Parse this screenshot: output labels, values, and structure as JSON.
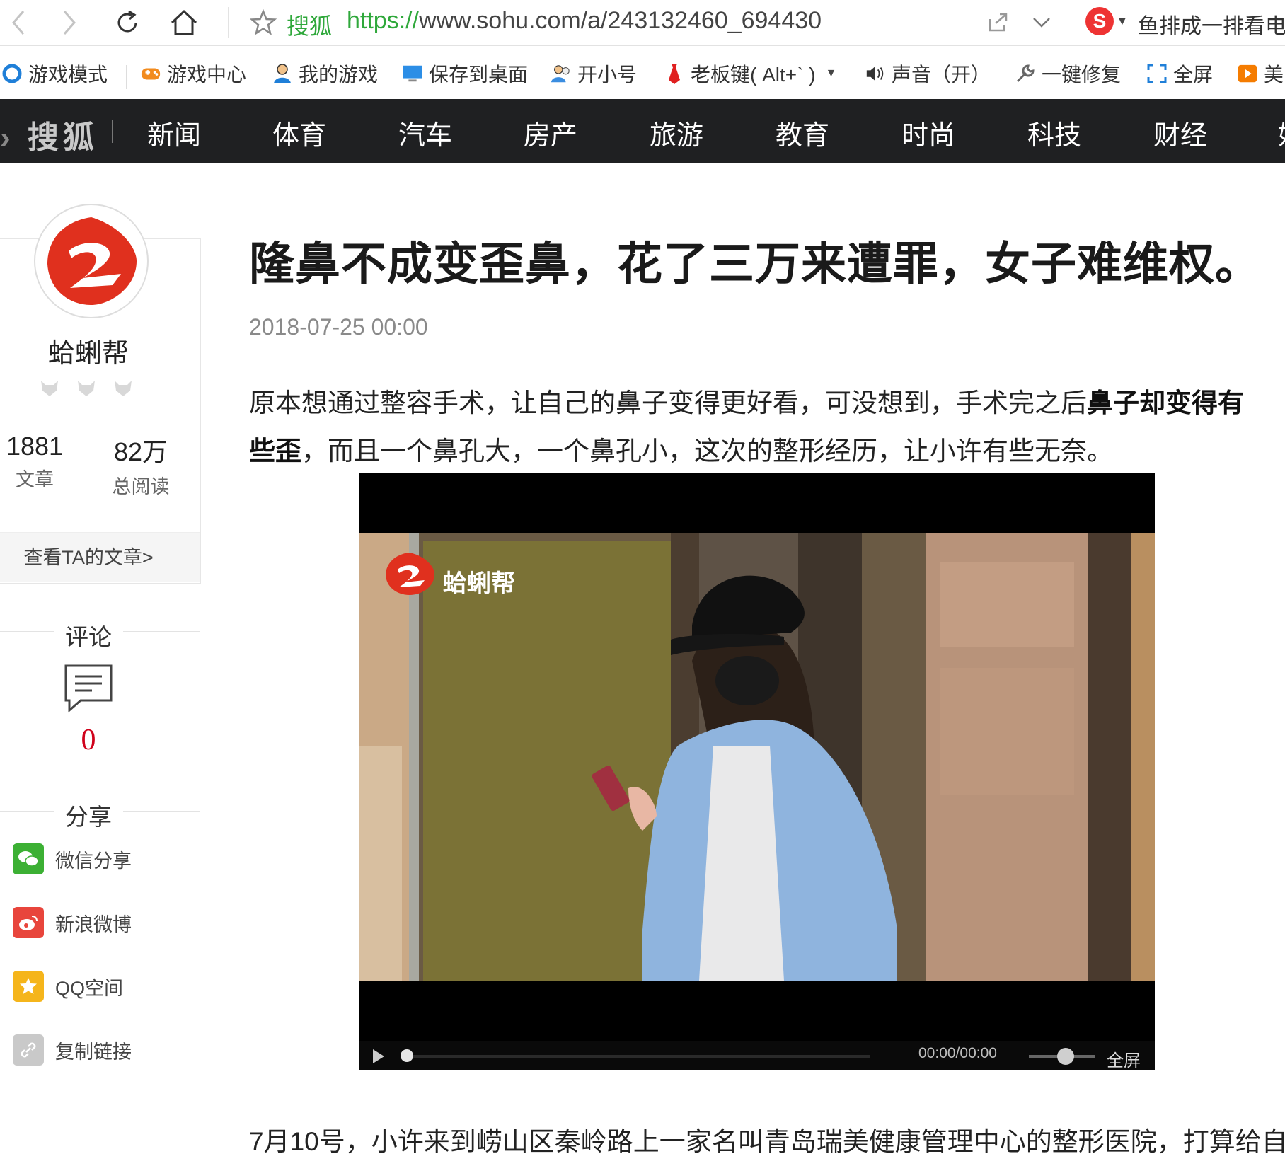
{
  "browser": {
    "site_label": "搜狐",
    "url_protocol": "https://",
    "url_rest": "www.sohu.com/a/243132460_694430",
    "search_hint": "鱼排成一排看电视"
  },
  "bookmarks": [
    {
      "label": "游戏模式",
      "icon": "ie-icon"
    },
    {
      "label": "游戏中心",
      "icon": "gamepad-icon"
    },
    {
      "label": "我的游戏",
      "icon": "user-icon"
    },
    {
      "label": "保存到桌面",
      "icon": "monitor-icon"
    },
    {
      "label": "开小号",
      "icon": "users-icon"
    },
    {
      "label": "老板键( Alt+` )",
      "icon": "tie-icon"
    },
    {
      "label": "声音（开）",
      "icon": "speaker-icon"
    },
    {
      "label": "一键修复",
      "icon": "wrench-icon"
    },
    {
      "label": "全屏",
      "icon": "fullscreen-icon"
    },
    {
      "label": "美",
      "icon": "play-icon"
    }
  ],
  "site": {
    "logo_text": "搜狐",
    "nav": [
      "新闻",
      "体育",
      "汽车",
      "房产",
      "旅游",
      "教育",
      "时尚",
      "科技",
      "财经",
      "娱"
    ]
  },
  "author": {
    "name": "蛤蜊帮",
    "articles": "1881",
    "articles_label": "文章",
    "reads": "82万",
    "reads_label": "总阅读",
    "view_link": "查看TA的文章>"
  },
  "comments": {
    "title": "评论",
    "count": "0"
  },
  "share": {
    "title": "分享",
    "items": [
      {
        "label": "微信分享",
        "color": "#3cb034"
      },
      {
        "label": "新浪微博",
        "color": "#e8453c"
      },
      {
        "label": "QQ空间",
        "color": "#f5b51b"
      },
      {
        "label": "复制链接",
        "color": "#c9c9c9"
      }
    ]
  },
  "article": {
    "title": "隆鼻不成变歪鼻，花了三万来遭罪，女子难维权。",
    "date": "2018-07-25 00:00",
    "para1_a": "原本想通过整容手术，让自己的鼻子变得更好看，可没想到，手术完之后",
    "para1_bold": "鼻子却变得有些歪",
    "para1_b": "，而且一个鼻孔大，一个鼻孔小，这次的整形经历，让小许有些无奈。",
    "para2": "7月10号，小许来到崂山区秦岭路上一家名叫青岛瑞美健康管理中心的整形医院，打算给自"
  },
  "video": {
    "watermark": "蛤蜊帮",
    "time": "00:00/00:00",
    "fullscreen": "全屏",
    "progress": 0,
    "volume": 0.55
  },
  "colors": {
    "brand_red": "#d0021b",
    "nav_bg": "#1f2022",
    "url_green": "#2fa83b"
  }
}
